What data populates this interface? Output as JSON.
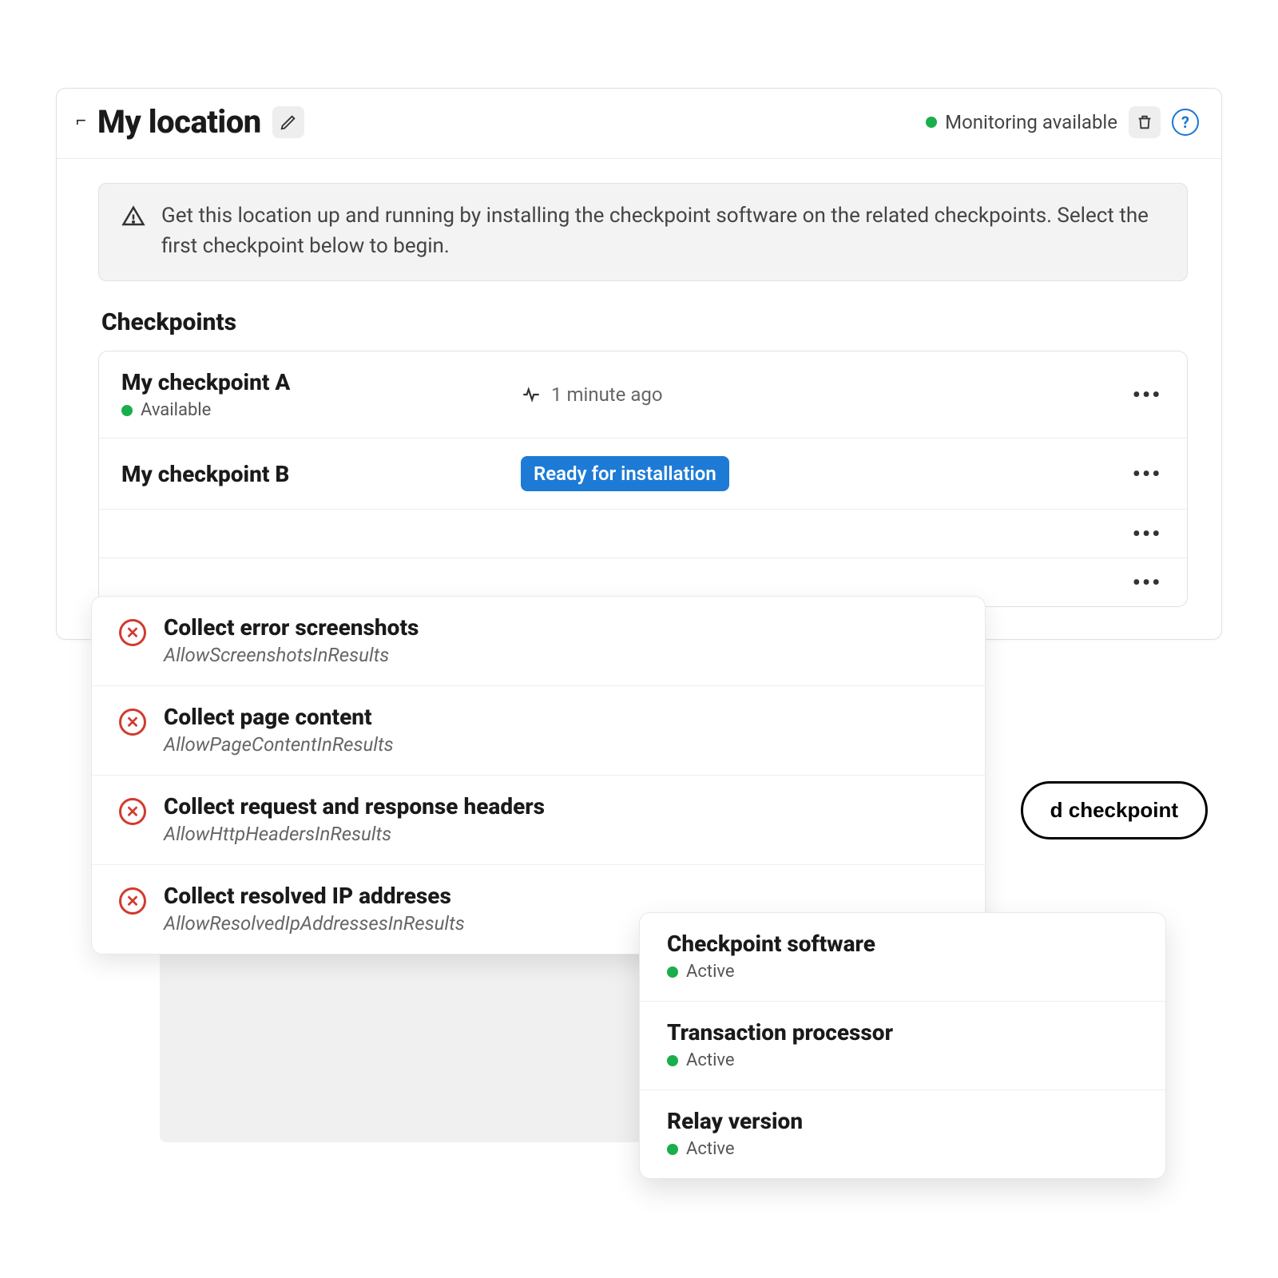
{
  "header": {
    "title": "My location",
    "status_label": "Monitoring available"
  },
  "alert": {
    "text": "Get this location up and running by installing the checkpoint software on the related checkpoints. Select the first checkpoint below to begin."
  },
  "section_title": "Checkpoints",
  "checkpoints": [
    {
      "name": "My checkpoint A",
      "status": "Available",
      "time": "1 minute ago",
      "has_time": true,
      "badge": "",
      "has_badge": false
    },
    {
      "name": "My checkpoint B",
      "status": "",
      "time": "",
      "has_time": false,
      "badge": "Ready for installation",
      "has_badge": true
    },
    {
      "name": "",
      "status": "",
      "time": "",
      "has_time": false,
      "badge": "",
      "has_badge": false
    },
    {
      "name": "",
      "status": "",
      "time": "",
      "has_time": false,
      "badge": "",
      "has_badge": false
    }
  ],
  "add_button_label_partial": "d checkpoint",
  "collect_panel": [
    {
      "title": "Collect error screenshots",
      "key": "AllowScreenshotsInResults"
    },
    {
      "title": "Collect page content",
      "key": "AllowPageContentInResults"
    },
    {
      "title": "Collect request and response headers",
      "key": "AllowHttpHeadersInResults"
    },
    {
      "title": "Collect resolved IP addreses",
      "key": "AllowResolvedIpAddressesInResults"
    }
  ],
  "status_panel": [
    {
      "name": "Checkpoint software",
      "status": "Active"
    },
    {
      "name": "Transaction processor",
      "status": "Active"
    },
    {
      "name": "Relay version",
      "status": "Active"
    }
  ],
  "kebab": "•••"
}
